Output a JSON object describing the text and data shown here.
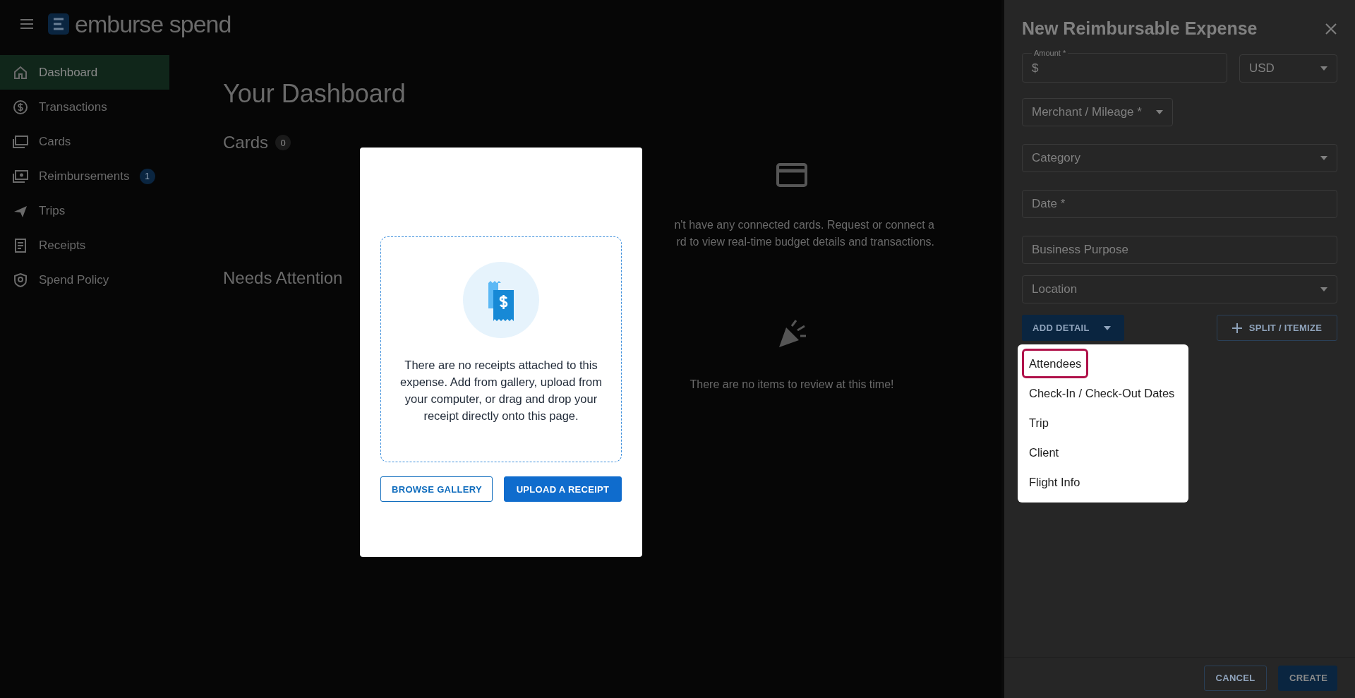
{
  "app": {
    "logo": "emburse spend"
  },
  "sidebar": {
    "items": [
      {
        "label": "Dashboard",
        "selected": true
      },
      {
        "label": "Transactions",
        "selected": false
      },
      {
        "label": "Cards",
        "selected": false
      },
      {
        "label": "Reimbursements",
        "selected": false,
        "badge": "1"
      },
      {
        "label": "Trips",
        "selected": false
      },
      {
        "label": "Receipts",
        "selected": false
      },
      {
        "label": "Spend Policy",
        "selected": false
      }
    ]
  },
  "dashboard": {
    "title": "Your Dashboard",
    "sections": [
      {
        "title": "Cards",
        "count": "0",
        "empty_state": {
          "kind": "card",
          "lines": [
            "n't have any connected cards. Request or connect a",
            "rd to view real-time budget details and transactions."
          ]
        }
      },
      {
        "title": "Needs Attention",
        "empty_state": {
          "kind": "party",
          "lines": [
            "There are no items to review at this time!"
          ]
        }
      }
    ]
  },
  "receipt_dialog": {
    "message": "There are no receipts attached to this expense. Add from gallery, upload from your computer, or drag and drop your receipt directly onto this page.",
    "buttons": [
      {
        "label": "BROWSE GALLERY",
        "kind": "outlined"
      },
      {
        "label": "UPLOAD A RECEIPT",
        "kind": "primary"
      }
    ]
  },
  "expense_panel": {
    "title": "New Reimbursable Expense",
    "rows": [
      [
        {
          "kind": "text",
          "label": "Amount *",
          "prefix": "$"
        },
        {
          "kind": "select",
          "value": "USD"
        }
      ],
      [
        {
          "kind": "picker",
          "placeholder": "Merchant / Mileage *"
        }
      ],
      [
        {
          "kind": "select",
          "placeholder": "Category"
        }
      ],
      [
        {
          "kind": "text",
          "placeholder": "Date *"
        }
      ],
      [
        {
          "kind": "text",
          "placeholder": "Business Purpose"
        }
      ],
      [
        {
          "kind": "select",
          "placeholder": "Location"
        }
      ]
    ],
    "add_detail": {
      "label": "ADD DETAIL",
      "expanded": true
    },
    "split": {
      "label": "SPLIT / ITEMIZE"
    },
    "menu": [
      {
        "label": "Attendees",
        "focused": true
      },
      {
        "label": "Check-In / Check-Out Dates",
        "focused": false
      },
      {
        "label": "Trip",
        "focused": false
      },
      {
        "label": "Client",
        "focused": false
      },
      {
        "label": "Flight Info",
        "focused": false
      }
    ],
    "footer_buttons": [
      {
        "label": "CANCEL",
        "kind": "outlined"
      },
      {
        "label": "CREATE",
        "kind": "primary"
      }
    ]
  }
}
